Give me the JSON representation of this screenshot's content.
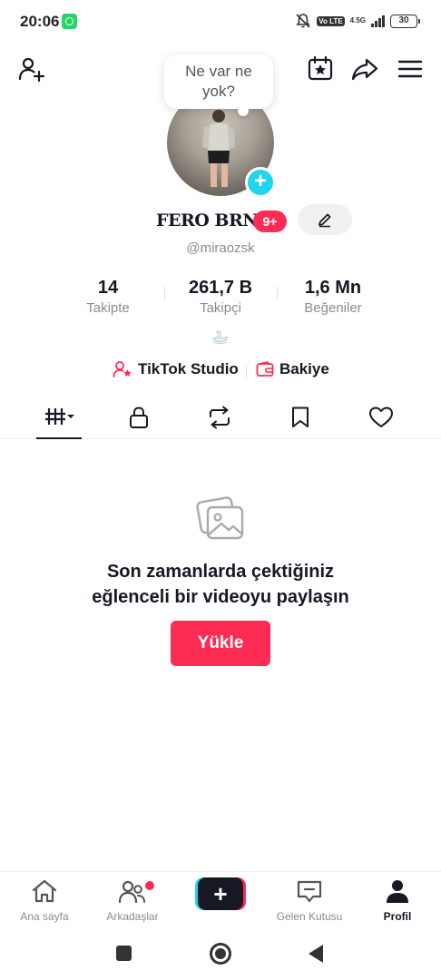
{
  "status_bar": {
    "time": "20:06",
    "network": "4.5G",
    "volte": "Vo LTE",
    "battery": "30"
  },
  "bubble": {
    "text_line1": "Ne var ne",
    "text_line2": "yok?"
  },
  "profile": {
    "display_name": "FERO BRN",
    "badge": "9+",
    "username": "@miraozsk"
  },
  "stats": {
    "following": {
      "value": "14",
      "label": "Takipte"
    },
    "followers": {
      "value": "261,7 B",
      "label": "Takipçi"
    },
    "likes": {
      "value": "1,6 Mn",
      "label": "Beğeniler"
    }
  },
  "links": {
    "studio": "TikTok Studio",
    "balance": "Bakiye"
  },
  "empty_state": {
    "line1": "Son zamanlarda çektiğiniz",
    "line2": "eğlenceli bir videoyu paylaşın",
    "button": "Yükle"
  },
  "bottom_nav": {
    "home": "Ana sayfa",
    "friends": "Arkadaşlar",
    "create": "+",
    "inbox": "Gelen Kutusu",
    "profile": "Profil"
  },
  "colors": {
    "accent": "#FE2C55",
    "cyan": "#20D5EC",
    "text": "#161823",
    "muted": "#8a8b91"
  }
}
